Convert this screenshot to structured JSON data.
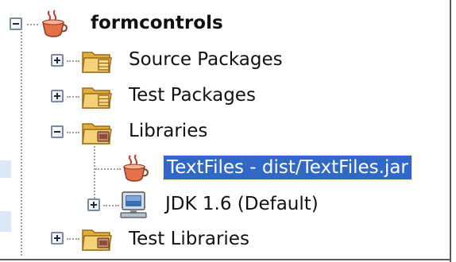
{
  "project_tree": {
    "root": {
      "label": "formcontrols",
      "expanded": true,
      "icon": "coffee-cup-project-icon"
    },
    "items": [
      {
        "label": "Source Packages",
        "expanded": false,
        "icon": "package-folder-icon"
      },
      {
        "label": "Test Packages",
        "expanded": false,
        "icon": "package-folder-icon"
      },
      {
        "label": "Libraries",
        "expanded": true,
        "icon": "library-folder-icon",
        "children": [
          {
            "label": "TextFiles - dist/TextFiles.jar",
            "selected": true,
            "icon": "coffee-cup-jar-icon"
          },
          {
            "label": "JDK 1.6 (Default)",
            "expanded": false,
            "icon": "jdk-monitor-icon"
          }
        ]
      },
      {
        "label": "Test Libraries",
        "expanded": false,
        "icon": "library-folder-icon"
      }
    ]
  },
  "colors": {
    "selection_background": "#3168c5",
    "selection_text": "#ffffff",
    "folder": "#f0c65a"
  }
}
